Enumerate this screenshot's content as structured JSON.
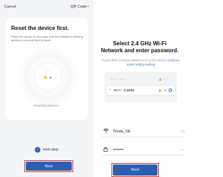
{
  "left": {
    "cancel_label": "Cancel",
    "qr_label": "QR Code",
    "title": "Reset the device first.",
    "description": "Power the device on and make sure the indicator is flashing quickly or a prompt tone is heard",
    "reset_caption": "Resetting Devices",
    "reset_arrow": "›",
    "confirm_label": "next step",
    "check_glyph": "✓",
    "next_label": "Next"
  },
  "right": {
    "title_line1": "Select 2.4 GHz Wi-Fi",
    "title_line2": "Network and enter password.",
    "desc_prefix": "If your Wi-Fi is 5GHz, please set it to be 2.4GHz.",
    "desc_link": "Common router setting method",
    "wifi_faded": "Wi-Fi - 5Ghz",
    "wifi_main_prefix": "Wi-Fi - ",
    "wifi_main_band": "2.4Ghz",
    "ssid_value": "Tenda_SE",
    "ssid_hint": "Fo",
    "password_value": "••••••••",
    "next_label": "Next"
  },
  "colors": {
    "accent_blue": "#2d5fb0",
    "highlight_red": "#d6332c",
    "check_green": "#2faa4f"
  },
  "icons": [
    "qr-code-icon",
    "resetting-device-illustration",
    "checkbox-checked-icon",
    "wifi-icon",
    "lock-icon",
    "eye-icon",
    "info-icon"
  ]
}
